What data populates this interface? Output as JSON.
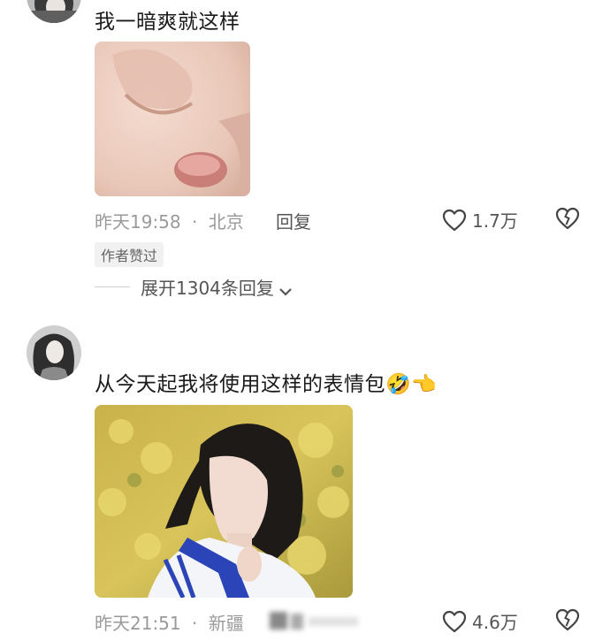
{
  "comments": [
    {
      "text": "我一暗爽就这样",
      "time": "昨天19:58",
      "separator": "·",
      "location": "北京",
      "reply_label": "回复",
      "likes": "1.7万",
      "badge": "作者赞过",
      "expand_label": "展开1304条回复"
    },
    {
      "text": "从今天起我将使用这样的表情包",
      "emoji": "🤣👈",
      "time": "昨天21:51",
      "separator": "·",
      "location": "新疆",
      "likes": "4.6万"
    }
  ],
  "icons": {
    "like": "heart-outline-icon",
    "dislike": "broken-heart-icon",
    "expand": "chevron-down-icon"
  },
  "colors": {
    "text": "#1a1a1a",
    "meta": "#9a9a9a",
    "badge_bg": "#f1f1f1"
  }
}
